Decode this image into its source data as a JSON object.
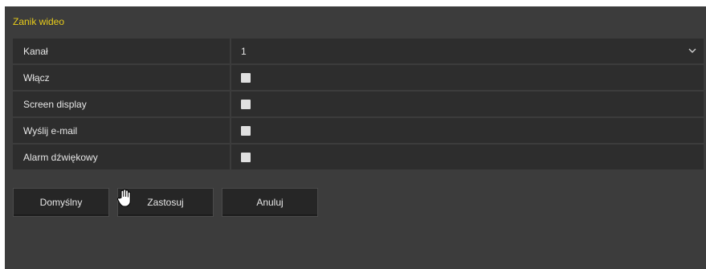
{
  "header": {
    "title": "Zanik wideo"
  },
  "form": {
    "channel": {
      "label": "Kanał",
      "value": "1"
    },
    "enable": {
      "label": "Włącz",
      "checked": false
    },
    "screen_display": {
      "label": "Screen display",
      "checked": false
    },
    "send_email": {
      "label": "Wyślij e-mail",
      "checked": false
    },
    "alarm_sound": {
      "label": "Alarm dźwiękowy",
      "checked": false
    }
  },
  "buttons": {
    "default_label": "Domyślny",
    "apply_label": "Zastosuj",
    "cancel_label": "Anuluj"
  },
  "icons": {
    "chevron": "chevron-down-icon",
    "cursor": "hand-cursor-icon"
  },
  "colors": {
    "title": "#e8cc1a",
    "panel": "#3c3c3c",
    "cell": "#2d2d2d",
    "text": "#e6e6e6"
  }
}
